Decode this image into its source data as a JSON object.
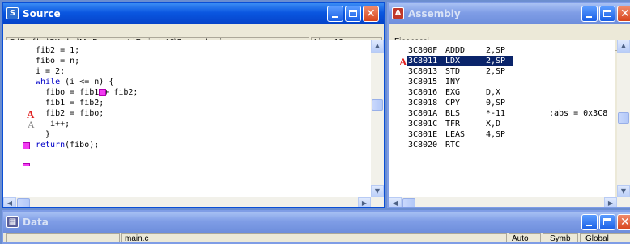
{
  "source": {
    "title": "Source",
    "path": "D:\\Profiles\\SKrylov\\My Documents\\Project_18\\Sources\\main.c",
    "line_status": "Line: 16",
    "lines": [
      {
        "indent": "fib2 = 1;",
        "kw": "",
        "rest": ""
      },
      {
        "indent": "fibo = n;",
        "kw": "",
        "rest": ""
      },
      {
        "indent": "i = 2;",
        "kw": "",
        "rest": ""
      },
      {
        "indent": "",
        "kw": "while",
        "rest": " (i <= n) {"
      },
      {
        "indent": "  fibo = fib1 + fib2;",
        "kw": "",
        "rest": ""
      },
      {
        "indent": "  fib1 = fib2;",
        "kw": "",
        "rest": ""
      },
      {
        "indent": "  fib2 = fibo;",
        "kw": "",
        "rest": ""
      },
      {
        "indent": "   i++;",
        "kw": "",
        "rest": ""
      },
      {
        "indent": "  }",
        "kw": "",
        "rest": ""
      },
      {
        "indent": "",
        "kw": "return",
        "rest": "(fibo);"
      }
    ]
  },
  "assembly": {
    "title": "Assembly",
    "function_name": "Fibonacci",
    "rows": [
      {
        "addr": "3C800F",
        "op": "ADDD",
        "arg": "2,SP",
        "comment": ""
      },
      {
        "addr": "3C8011",
        "op": "LDX",
        "arg": "2,SP",
        "comment": ""
      },
      {
        "addr": "3C8013",
        "op": "STD",
        "arg": "2,SP",
        "comment": ""
      },
      {
        "addr": "3C8015",
        "op": "INY",
        "arg": "",
        "comment": ""
      },
      {
        "addr": "3C8016",
        "op": "EXG",
        "arg": "D,X",
        "comment": ""
      },
      {
        "addr": "3C8018",
        "op": "CPY",
        "arg": "0,SP",
        "comment": ""
      },
      {
        "addr": "3C801A",
        "op": "BLS",
        "arg": "*-11",
        "comment": ";abs = 0x3C8"
      },
      {
        "addr": "3C801C",
        "op": "TFR",
        "arg": "X,D",
        "comment": ""
      },
      {
        "addr": "3C801E",
        "op": "LEAS",
        "arg": "4,SP",
        "comment": ""
      },
      {
        "addr": "3C8020",
        "op": "RTC",
        "arg": "",
        "comment": ""
      }
    ]
  },
  "data": {
    "title": "Data",
    "file": "main.c",
    "mode1": "Auto",
    "mode2": "Symb",
    "mode3": "Global"
  },
  "markers": {
    "breakpoint_letter": "A"
  }
}
